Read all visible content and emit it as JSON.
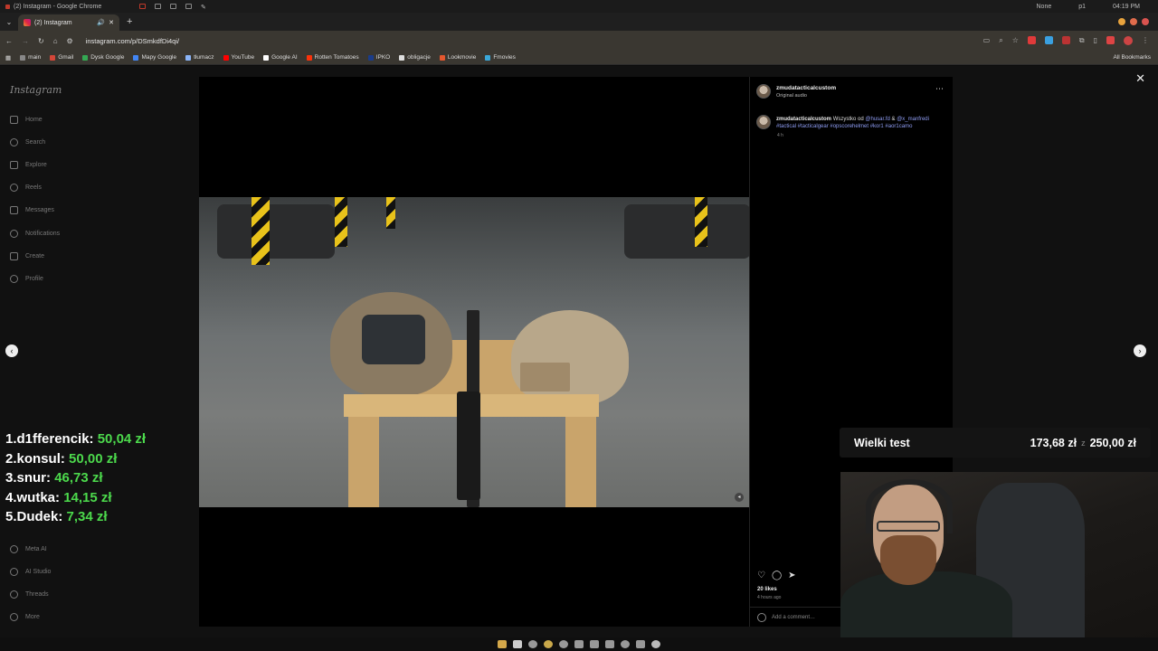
{
  "os": {
    "window_title": "(2) Instagram - Google Chrome",
    "status_user": "None",
    "status_p": "p1",
    "clock": "04:19 PM"
  },
  "browser": {
    "tab_title": "(2) Instagram",
    "url": "instagram.com/p/DSmkdfDi4qi/",
    "bookmarks": [
      "main",
      "Gmail",
      "Dysk Google",
      "Mapy Google",
      "tłumacz",
      "YouTube",
      "Google AI",
      "Rotten Tomatoes",
      "IPKO",
      "obligacje",
      "Lookmovie",
      "Fmovies"
    ],
    "bookmark_colors": [
      "#888888",
      "#d44638",
      "#34a853",
      "#4285f4",
      "#8ab4f8",
      "#ff0000",
      "#ffffff",
      "#fa320a",
      "#1a3c8a",
      "#dddddd",
      "#e4572e",
      "#3aa7d8"
    ],
    "all_bookmarks": "All Bookmarks"
  },
  "instagram": {
    "logo": "Instagram",
    "sidebar": [
      "Home",
      "Search",
      "Explore",
      "Reels",
      "Messages",
      "Notifications",
      "Create",
      "Profile"
    ],
    "sidebar_bottom": [
      "Meta AI",
      "AI Studio",
      "Threads",
      "More"
    ]
  },
  "post": {
    "username": "zmudatacticalcustom",
    "audio": "Original audio",
    "caption_user": "zmudatacticalcustom",
    "caption_text": "Wszystko od",
    "mention1": "@husar.fd",
    "amp": "&",
    "mention2": "@x_manfredi",
    "hashtags": "#tactical #tacticalgear #opscorehelmet #kor1 #aor1camo",
    "caption_time": "4 h",
    "likes": "20 likes",
    "ago": "4 hours ago",
    "comment_placeholder": "Add a comment…"
  },
  "leaderboard": [
    {
      "rank": "1.",
      "name": "d1fferencik:",
      "amount": "50,04 zł"
    },
    {
      "rank": "2.",
      "name": "konsul:",
      "amount": "50,00 zł"
    },
    {
      "rank": "3.",
      "name": "snur:",
      "amount": "46,73 zł"
    },
    {
      "rank": "4.",
      "name": "wutka:",
      "amount": "14,15 zł"
    },
    {
      "rank": "5.",
      "name": "Dudek:",
      "amount": "7,34 zł"
    }
  ],
  "goal": {
    "title": "Wielki test",
    "current": "173,68 zł",
    "sep": "z",
    "target": "250,00 zł"
  },
  "colors": {
    "accent_green": "#4cd94c",
    "link_blue": "#8e9cf2"
  }
}
